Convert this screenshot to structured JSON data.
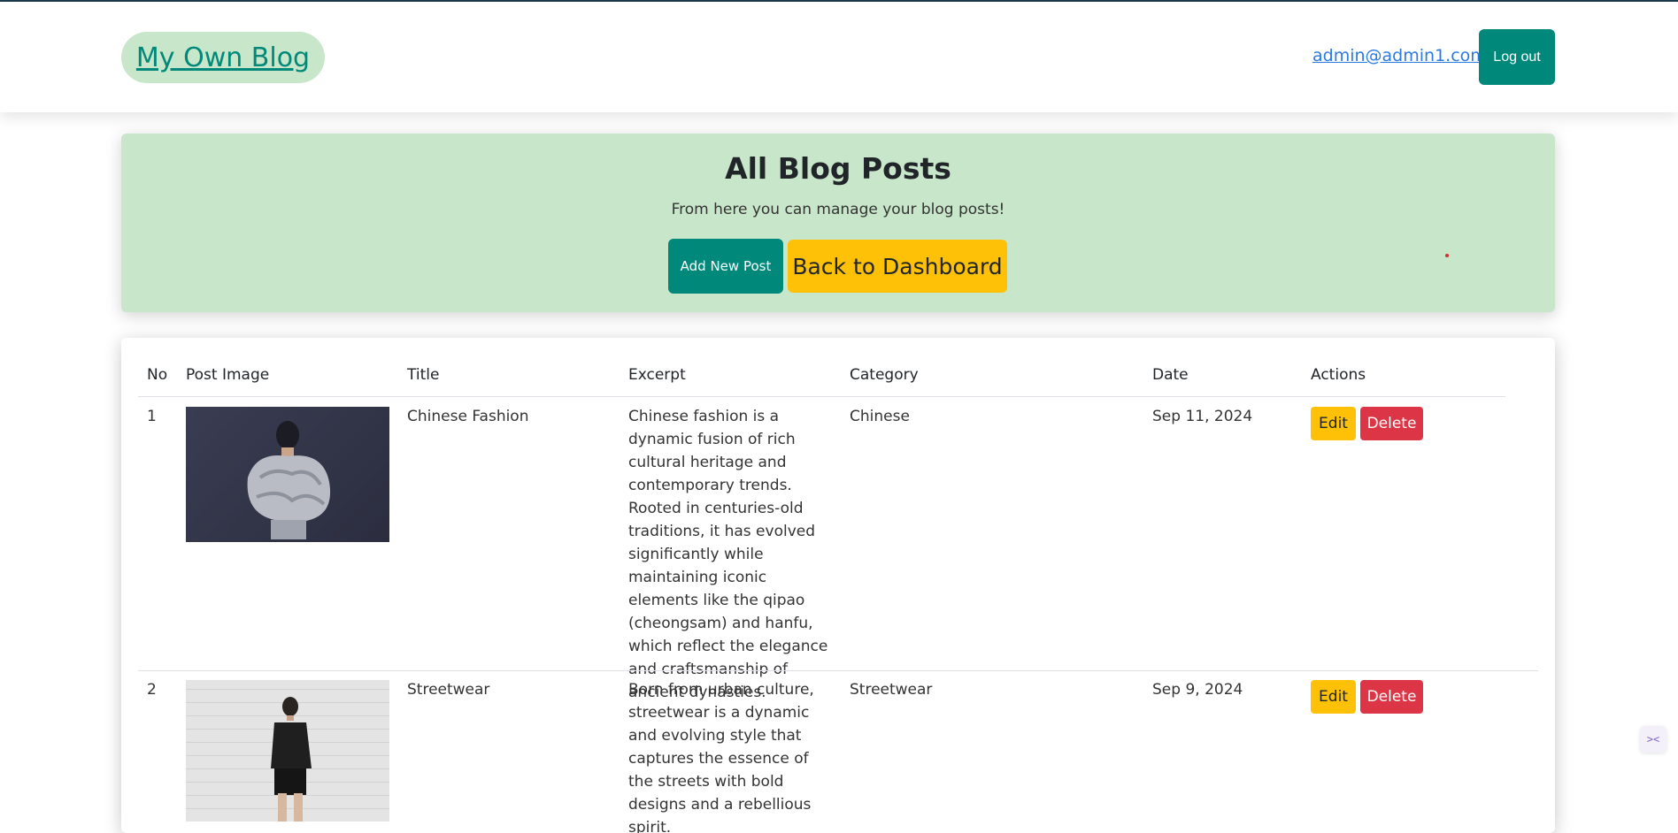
{
  "navbar": {
    "brand": "My Own Blog",
    "user_email": "admin@admin1.com",
    "logout_label": "Log out"
  },
  "hero": {
    "title": "All Blog Posts",
    "subtitle": "From here you can manage your blog posts!",
    "add_label": "Add New Post",
    "back_label": "Back to Dashboard"
  },
  "table": {
    "headers": [
      "No",
      "Post Image",
      "Title",
      "Excerpt",
      "Category",
      "Date",
      "Actions"
    ],
    "rows": [
      {
        "no": "1",
        "title": "Chinese Fashion",
        "excerpt": "Chinese fashion is a dynamic fusion of rich cultural heritage and contemporary trends. Rooted in centuries-old traditions, it has evolved significantly while maintaining iconic elements like the qipao (cheongsam) and hanfu, which reflect the elegance and craftsmanship of ancient dynasties.",
        "category": "Chinese",
        "date": "Sep 11, 2024",
        "edit_label": "Edit",
        "delete_label": "Delete"
      },
      {
        "no": "2",
        "title": "Streetwear",
        "excerpt": "Born from urban culture, streetwear is a dynamic and evolving style that captures the essence of the streets with bold designs and a rebellious spirit.",
        "category": "Streetwear",
        "date": "Sep 9, 2024",
        "edit_label": "Edit",
        "delete_label": "Delete"
      }
    ]
  },
  "extension_icon": "code-brackets-icon",
  "colors": {
    "brand_bg": "#c8e6c9",
    "primary": "#00897b",
    "warning": "#ffc107",
    "danger": "#dc3545",
    "link": "#2a7ae2"
  }
}
